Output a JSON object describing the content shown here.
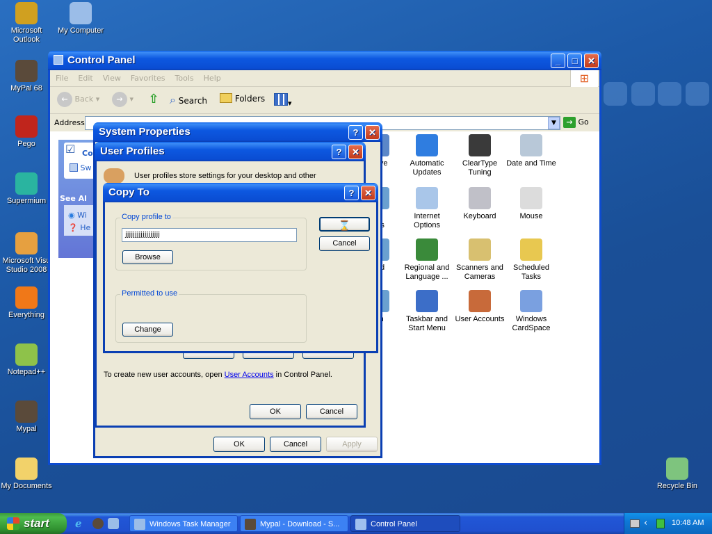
{
  "desktop": {
    "icons": [
      {
        "label": "Microsoft\nOutlook",
        "icon": "outlook-icon",
        "color": "#d0a020"
      },
      {
        "label": "My Computer",
        "icon": "my-computer-icon",
        "color": "#9bbde8"
      },
      {
        "label": "MyPal 68",
        "icon": "raccoon-icon",
        "color": "#5a4a3a"
      },
      {
        "label": "Pego",
        "icon": "red-ball-icon",
        "color": "#c0251c"
      },
      {
        "label": "Supermium",
        "icon": "supermium-icon",
        "color": "#2ab4a0"
      },
      {
        "label": "Microsoft Visu\nStudio 2008",
        "icon": "visual-studio-icon",
        "color": "#e6a040"
      },
      {
        "label": "Everything",
        "icon": "everything-icon",
        "color": "#f07818"
      },
      {
        "label": "Notepad++",
        "icon": "notepadpp-icon",
        "color": "#8ec24a"
      },
      {
        "label": "Mypal",
        "icon": "raccoon-icon",
        "color": "#5a4a3a"
      },
      {
        "label": "My Documents",
        "icon": "folder-icon",
        "color": "#f2d26a"
      },
      {
        "label": "Recycle Bin",
        "icon": "recycle-bin-icon",
        "color": "#7ec47e"
      }
    ]
  },
  "control_panel": {
    "title": "Control Panel",
    "menu": [
      "File",
      "Edit",
      "View",
      "Favorites",
      "Tools",
      "Help"
    ],
    "toolbar": {
      "back": "Back",
      "search": "Search",
      "folders": "Folders"
    },
    "address_label": "Address",
    "go_label": "Go",
    "side_visible": [
      "Co",
      "Sw",
      "See Al",
      "Wi",
      "He"
    ],
    "items": [
      {
        "label": "rative\ns",
        "color": "#5b87c8"
      },
      {
        "label": "Automatic\nUpdates",
        "color": "#2f7de0"
      },
      {
        "label": "ClearType\nTuning",
        "color": "#3a3a3a"
      },
      {
        "label": "Date and Time",
        "color": "#b8c8d8"
      },
      {
        "label": "e\nlers",
        "color": "#6aa0d0"
      },
      {
        "label": "Internet\nOptions",
        "color": "#a9c6e9"
      },
      {
        "label": "Keyboard",
        "color": "#c0c0c8"
      },
      {
        "label": "Mouse",
        "color": "#dcdcdc"
      },
      {
        "label": "and\ns",
        "color": "#6aa0d0"
      },
      {
        "label": "Regional and\nLanguage ...",
        "color": "#3a8a3a"
      },
      {
        "label": "Scanners and\nCameras",
        "color": "#d8c070"
      },
      {
        "label": "Scheduled\nTasks",
        "color": "#e8c850"
      },
      {
        "label": "em",
        "color": "#6aa0d0"
      },
      {
        "label": "Taskbar and\nStart Menu",
        "color": "#3c6ec8"
      },
      {
        "label": "User Accounts",
        "color": "#c86a3a"
      },
      {
        "label": "Windows\nCardSpace",
        "color": "#7aa0e0"
      }
    ]
  },
  "system_properties": {
    "title": "System Properties",
    "ok": "OK",
    "cancel": "Cancel",
    "apply": "Apply"
  },
  "user_profiles": {
    "title": "User Profiles",
    "description": "User profiles store settings for your desktop and other",
    "footer_prefix": "To create new user accounts, open ",
    "footer_link": "User Accounts",
    "footer_suffix": " in Control Panel.",
    "ok": "OK",
    "cancel": "Cancel"
  },
  "copy_to": {
    "title": "Copy To",
    "copy_group": "Copy profile to",
    "path_value": "jjjjjjjjjjjjjjjjjj",
    "browse": "Browse",
    "cancel": "Cancel",
    "permitted_group": "Permitted to use",
    "change": "Change"
  },
  "taskbar": {
    "start": "start",
    "tasks": [
      {
        "label": "Windows Task Manager",
        "active": false
      },
      {
        "label": "Mypal - Download - S...",
        "active": false
      },
      {
        "label": "Control Panel",
        "active": true
      }
    ],
    "clock": "10:48 AM"
  }
}
